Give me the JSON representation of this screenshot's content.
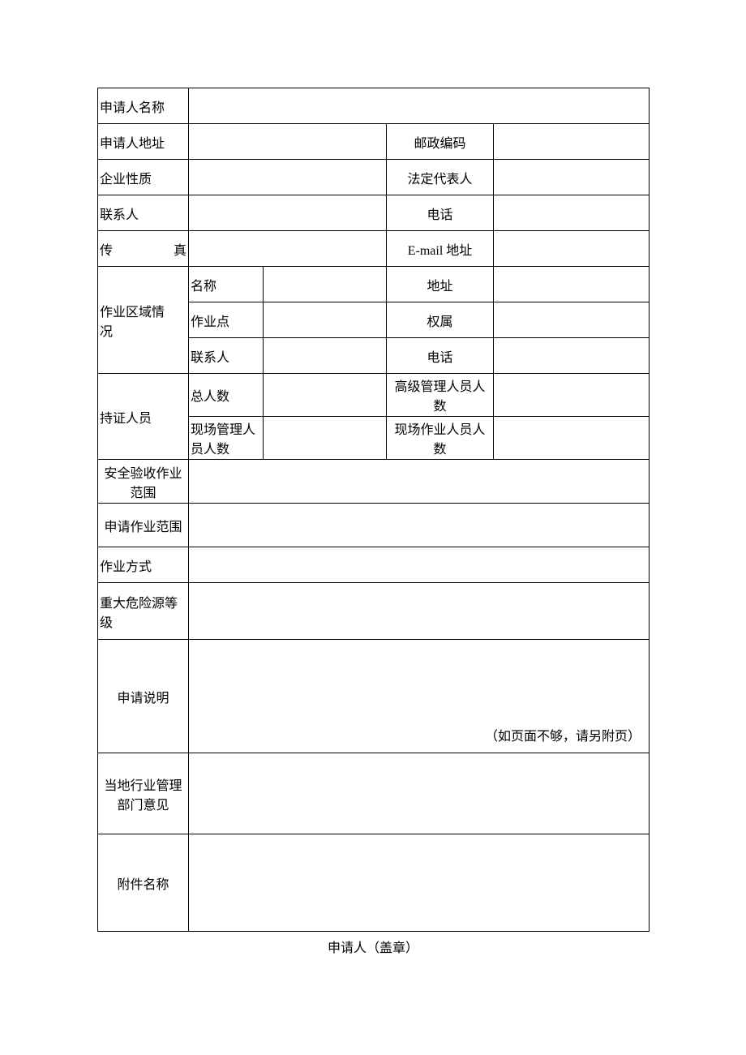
{
  "labels": {
    "applicant_name": "申请人名称",
    "applicant_address": "申请人地址",
    "postal_code": "邮政编码",
    "enterprise_nature": "企业性质",
    "legal_rep": "法定代表人",
    "contact_person": "联系人",
    "phone": "电话",
    "fax": "传　　　真",
    "email": "E-mail 地址",
    "work_area_header": "作业区域情　　　况",
    "wa_name": "名称",
    "wa_address": "地址",
    "wa_point": "作业点",
    "wa_ownership": "权属",
    "wa_contact": "联系人",
    "wa_phone": "电话",
    "cert_personnel_header": "持证人员",
    "cp_total": "总人数",
    "cp_senior": "高级管理人员人数",
    "cp_site_mgmt": "现场管理人员人数",
    "cp_site_work": "现场作业人员人数",
    "safety_scope": "安全验收作业范围",
    "apply_scope": "申请作业范围",
    "work_method": "作业方式",
    "hazard_level": "重大危险源等　　　级",
    "apply_desc": "申请说明",
    "apply_desc_note": "（如页面不够，请另附页）",
    "local_dept_opinion": "当地行业管理部门意见",
    "attachment_name": "附件名称"
  },
  "values": {
    "applicant_name": "",
    "applicant_address": "",
    "postal_code": "",
    "enterprise_nature": "",
    "legal_rep": "",
    "contact_person": "",
    "phone": "",
    "fax": "",
    "email": "",
    "wa_name": "",
    "wa_address": "",
    "wa_point": "",
    "wa_ownership": "",
    "wa_contact": "",
    "wa_phone": "",
    "cp_total": "",
    "cp_senior": "",
    "cp_site_mgmt": "",
    "cp_site_work": "",
    "safety_scope": "",
    "apply_scope": "",
    "work_method": "",
    "hazard_level": "",
    "apply_desc": "",
    "local_dept_opinion": "",
    "attachment_name": ""
  },
  "footer": "申请人（盖章）"
}
